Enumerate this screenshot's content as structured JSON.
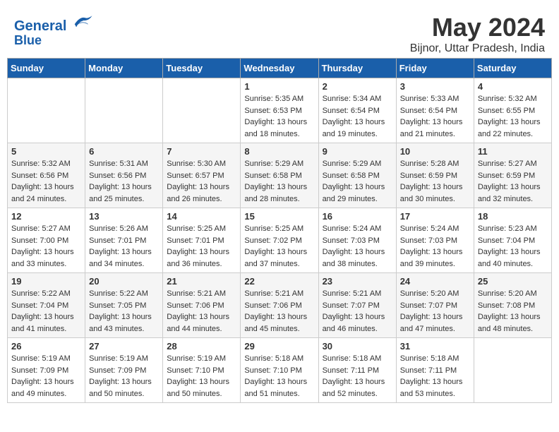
{
  "header": {
    "logo_line1": "General",
    "logo_line2": "Blue",
    "month": "May 2024",
    "location": "Bijnor, Uttar Pradesh, India"
  },
  "days_of_week": [
    "Sunday",
    "Monday",
    "Tuesday",
    "Wednesday",
    "Thursday",
    "Friday",
    "Saturday"
  ],
  "weeks": [
    [
      {
        "day": "",
        "info": ""
      },
      {
        "day": "",
        "info": ""
      },
      {
        "day": "",
        "info": ""
      },
      {
        "day": "1",
        "sunrise": "Sunrise: 5:35 AM",
        "sunset": "Sunset: 6:53 PM",
        "daylight": "Daylight: 13 hours and 18 minutes."
      },
      {
        "day": "2",
        "sunrise": "Sunrise: 5:34 AM",
        "sunset": "Sunset: 6:54 PM",
        "daylight": "Daylight: 13 hours and 19 minutes."
      },
      {
        "day": "3",
        "sunrise": "Sunrise: 5:33 AM",
        "sunset": "Sunset: 6:54 PM",
        "daylight": "Daylight: 13 hours and 21 minutes."
      },
      {
        "day": "4",
        "sunrise": "Sunrise: 5:32 AM",
        "sunset": "Sunset: 6:55 PM",
        "daylight": "Daylight: 13 hours and 22 minutes."
      }
    ],
    [
      {
        "day": "5",
        "sunrise": "Sunrise: 5:32 AM",
        "sunset": "Sunset: 6:56 PM",
        "daylight": "Daylight: 13 hours and 24 minutes."
      },
      {
        "day": "6",
        "sunrise": "Sunrise: 5:31 AM",
        "sunset": "Sunset: 6:56 PM",
        "daylight": "Daylight: 13 hours and 25 minutes."
      },
      {
        "day": "7",
        "sunrise": "Sunrise: 5:30 AM",
        "sunset": "Sunset: 6:57 PM",
        "daylight": "Daylight: 13 hours and 26 minutes."
      },
      {
        "day": "8",
        "sunrise": "Sunrise: 5:29 AM",
        "sunset": "Sunset: 6:58 PM",
        "daylight": "Daylight: 13 hours and 28 minutes."
      },
      {
        "day": "9",
        "sunrise": "Sunrise: 5:29 AM",
        "sunset": "Sunset: 6:58 PM",
        "daylight": "Daylight: 13 hours and 29 minutes."
      },
      {
        "day": "10",
        "sunrise": "Sunrise: 5:28 AM",
        "sunset": "Sunset: 6:59 PM",
        "daylight": "Daylight: 13 hours and 30 minutes."
      },
      {
        "day": "11",
        "sunrise": "Sunrise: 5:27 AM",
        "sunset": "Sunset: 6:59 PM",
        "daylight": "Daylight: 13 hours and 32 minutes."
      }
    ],
    [
      {
        "day": "12",
        "sunrise": "Sunrise: 5:27 AM",
        "sunset": "Sunset: 7:00 PM",
        "daylight": "Daylight: 13 hours and 33 minutes."
      },
      {
        "day": "13",
        "sunrise": "Sunrise: 5:26 AM",
        "sunset": "Sunset: 7:01 PM",
        "daylight": "Daylight: 13 hours and 34 minutes."
      },
      {
        "day": "14",
        "sunrise": "Sunrise: 5:25 AM",
        "sunset": "Sunset: 7:01 PM",
        "daylight": "Daylight: 13 hours and 36 minutes."
      },
      {
        "day": "15",
        "sunrise": "Sunrise: 5:25 AM",
        "sunset": "Sunset: 7:02 PM",
        "daylight": "Daylight: 13 hours and 37 minutes."
      },
      {
        "day": "16",
        "sunrise": "Sunrise: 5:24 AM",
        "sunset": "Sunset: 7:03 PM",
        "daylight": "Daylight: 13 hours and 38 minutes."
      },
      {
        "day": "17",
        "sunrise": "Sunrise: 5:24 AM",
        "sunset": "Sunset: 7:03 PM",
        "daylight": "Daylight: 13 hours and 39 minutes."
      },
      {
        "day": "18",
        "sunrise": "Sunrise: 5:23 AM",
        "sunset": "Sunset: 7:04 PM",
        "daylight": "Daylight: 13 hours and 40 minutes."
      }
    ],
    [
      {
        "day": "19",
        "sunrise": "Sunrise: 5:22 AM",
        "sunset": "Sunset: 7:04 PM",
        "daylight": "Daylight: 13 hours and 41 minutes."
      },
      {
        "day": "20",
        "sunrise": "Sunrise: 5:22 AM",
        "sunset": "Sunset: 7:05 PM",
        "daylight": "Daylight: 13 hours and 43 minutes."
      },
      {
        "day": "21",
        "sunrise": "Sunrise: 5:21 AM",
        "sunset": "Sunset: 7:06 PM",
        "daylight": "Daylight: 13 hours and 44 minutes."
      },
      {
        "day": "22",
        "sunrise": "Sunrise: 5:21 AM",
        "sunset": "Sunset: 7:06 PM",
        "daylight": "Daylight: 13 hours and 45 minutes."
      },
      {
        "day": "23",
        "sunrise": "Sunrise: 5:21 AM",
        "sunset": "Sunset: 7:07 PM",
        "daylight": "Daylight: 13 hours and 46 minutes."
      },
      {
        "day": "24",
        "sunrise": "Sunrise: 5:20 AM",
        "sunset": "Sunset: 7:07 PM",
        "daylight": "Daylight: 13 hours and 47 minutes."
      },
      {
        "day": "25",
        "sunrise": "Sunrise: 5:20 AM",
        "sunset": "Sunset: 7:08 PM",
        "daylight": "Daylight: 13 hours and 48 minutes."
      }
    ],
    [
      {
        "day": "26",
        "sunrise": "Sunrise: 5:19 AM",
        "sunset": "Sunset: 7:09 PM",
        "daylight": "Daylight: 13 hours and 49 minutes."
      },
      {
        "day": "27",
        "sunrise": "Sunrise: 5:19 AM",
        "sunset": "Sunset: 7:09 PM",
        "daylight": "Daylight: 13 hours and 50 minutes."
      },
      {
        "day": "28",
        "sunrise": "Sunrise: 5:19 AM",
        "sunset": "Sunset: 7:10 PM",
        "daylight": "Daylight: 13 hours and 50 minutes."
      },
      {
        "day": "29",
        "sunrise": "Sunrise: 5:18 AM",
        "sunset": "Sunset: 7:10 PM",
        "daylight": "Daylight: 13 hours and 51 minutes."
      },
      {
        "day": "30",
        "sunrise": "Sunrise: 5:18 AM",
        "sunset": "Sunset: 7:11 PM",
        "daylight": "Daylight: 13 hours and 52 minutes."
      },
      {
        "day": "31",
        "sunrise": "Sunrise: 5:18 AM",
        "sunset": "Sunset: 7:11 PM",
        "daylight": "Daylight: 13 hours and 53 minutes."
      },
      {
        "day": "",
        "info": ""
      }
    ]
  ]
}
